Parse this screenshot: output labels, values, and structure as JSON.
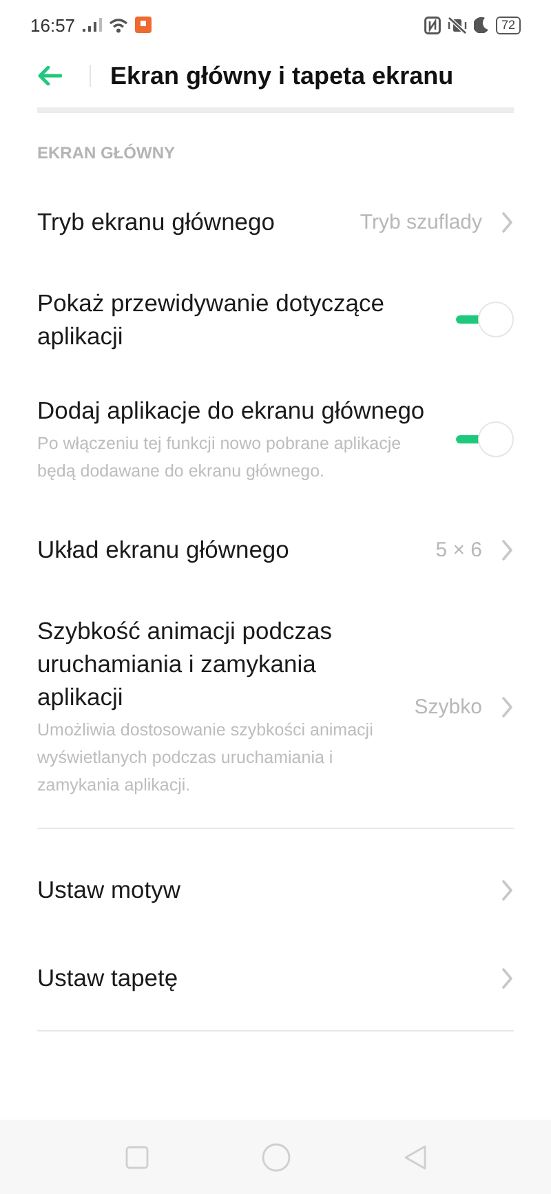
{
  "status_bar": {
    "time": "16:57",
    "battery": "72"
  },
  "header": {
    "title": "Ekran główny i tapeta ekranu"
  },
  "sections": [
    {
      "title": "EKRAN GŁÓWNY",
      "items": [
        {
          "kind": "link",
          "label": "Tryb ekranu głównego",
          "value": "Tryb szuflady"
        },
        {
          "kind": "toggle",
          "label": "Pokaż przewidywanie dotyczące aplikacji",
          "on": true
        },
        {
          "kind": "toggle",
          "label": "Dodaj aplikacje do ekranu głównego",
          "description": "Po włączeniu tej funkcji nowo pobrane aplikacje będą dodawane do ekranu głównego.",
          "on": true
        },
        {
          "kind": "link",
          "label": "Układ ekranu głównego",
          "value": "5 × 6"
        },
        {
          "kind": "link",
          "label": "Szybkość animacji podczas uruchamiania i zamykania aplikacji",
          "description": "Umożliwia dostosowanie szybkości animacji wyświetlanych podczas uruchamiania i zamykania aplikacji.",
          "value": "Szybko"
        }
      ]
    },
    {
      "items": [
        {
          "kind": "link",
          "label": "Ustaw motyw"
        },
        {
          "kind": "link",
          "label": "Ustaw tapetę"
        }
      ]
    }
  ]
}
